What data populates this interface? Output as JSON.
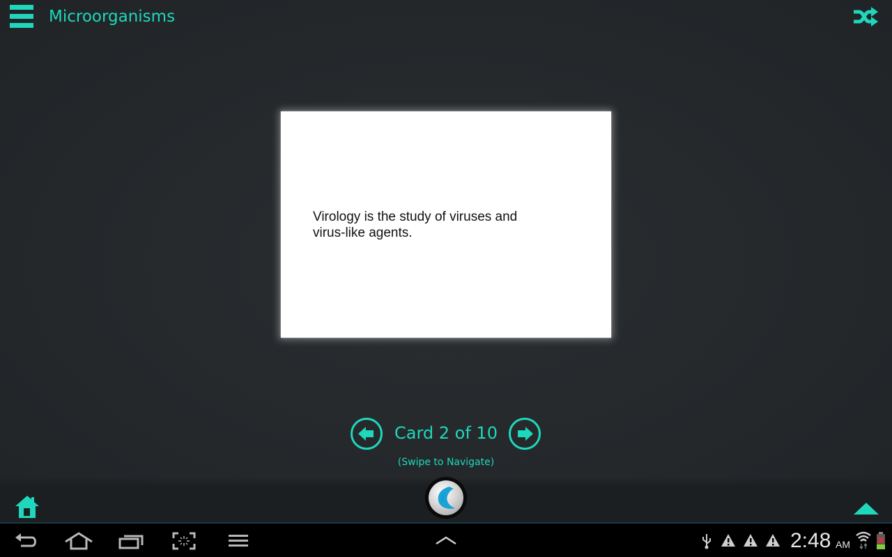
{
  "header": {
    "title": "Microorganisms",
    "menu_icon": "hamburger-menu-icon",
    "shuffle_icon": "shuffle-icon"
  },
  "card": {
    "text": "Virology is the study of viruses and virus-like agents."
  },
  "navigation": {
    "counter_label": "Card 2 of 10",
    "current_card": 2,
    "total_cards": 10,
    "hint": "(Swipe to Navigate)",
    "prev_icon": "arrow-left-circle-icon",
    "next_icon": "arrow-right-circle-icon"
  },
  "bottom_bar": {
    "home_icon": "home-icon",
    "logo_icon": "app-logo-icon",
    "expand_icon": "triangle-up-icon"
  },
  "system_bar": {
    "buttons": [
      "back",
      "home",
      "recent-apps",
      "screenshot",
      "menu"
    ],
    "center_icon": "chevron-up-icon",
    "status_icons": [
      "usb-icon",
      "warning-icon",
      "warning-icon",
      "warning-icon"
    ],
    "time": "2:48",
    "ampm": "AM",
    "wifi_icon": "wifi-icon",
    "battery_icon": "battery-icon"
  },
  "colors": {
    "accent": "#1fd8bb",
    "background": "#24282b",
    "bottom_bar": "#1b1f22",
    "card": "#ffffff"
  }
}
